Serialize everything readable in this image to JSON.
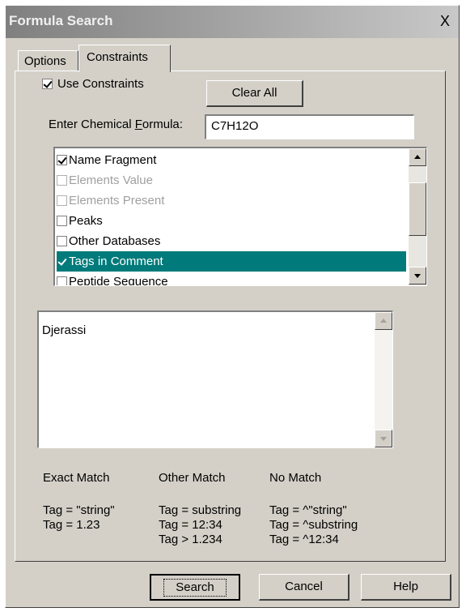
{
  "window": {
    "title": "Formula Search",
    "close_label": "X"
  },
  "tabs": [
    {
      "label": "Options"
    },
    {
      "label": "Constraints"
    }
  ],
  "use_constraints": {
    "label": "Use Constraints",
    "checked": true
  },
  "clear_all_label": "Clear All",
  "formula": {
    "label_prefix": "Enter Chemical ",
    "label_accel": "F",
    "label_suffix": "ormula:",
    "value": "C7H12O"
  },
  "constraint_list": {
    "items": [
      {
        "label": "Name Fragment",
        "checked": true,
        "enabled": true,
        "selected": false
      },
      {
        "label": "Elements Value",
        "checked": false,
        "enabled": false,
        "selected": false
      },
      {
        "label": "Elements Present",
        "checked": false,
        "enabled": false,
        "selected": false
      },
      {
        "label": "Peaks",
        "checked": false,
        "enabled": true,
        "selected": false
      },
      {
        "label": "Other Databases",
        "checked": false,
        "enabled": true,
        "selected": false
      },
      {
        "label": "Tags in Comment",
        "checked": true,
        "enabled": true,
        "selected": true
      },
      {
        "label": "Peptide Sequence",
        "checked": false,
        "enabled": true,
        "selected": false
      }
    ]
  },
  "comment_text": "Djerassi",
  "help_columns": [
    {
      "heading": "Exact Match",
      "lines": [
        "Tag = \"string\"",
        "Tag = 1.23"
      ]
    },
    {
      "heading": "Other Match",
      "lines": [
        "Tag = substring",
        "Tag = 12:34",
        "Tag > 1.234"
      ]
    },
    {
      "heading": "No Match",
      "lines": [
        "Tag = ^\"string\"",
        "Tag = ^substring",
        "Tag = ^12:34"
      ]
    }
  ],
  "buttons": {
    "search": "Search",
    "cancel": "Cancel",
    "help": "Help"
  },
  "colors": {
    "selection": "#007a7a",
    "dialog_face": "#d4d0c8"
  }
}
